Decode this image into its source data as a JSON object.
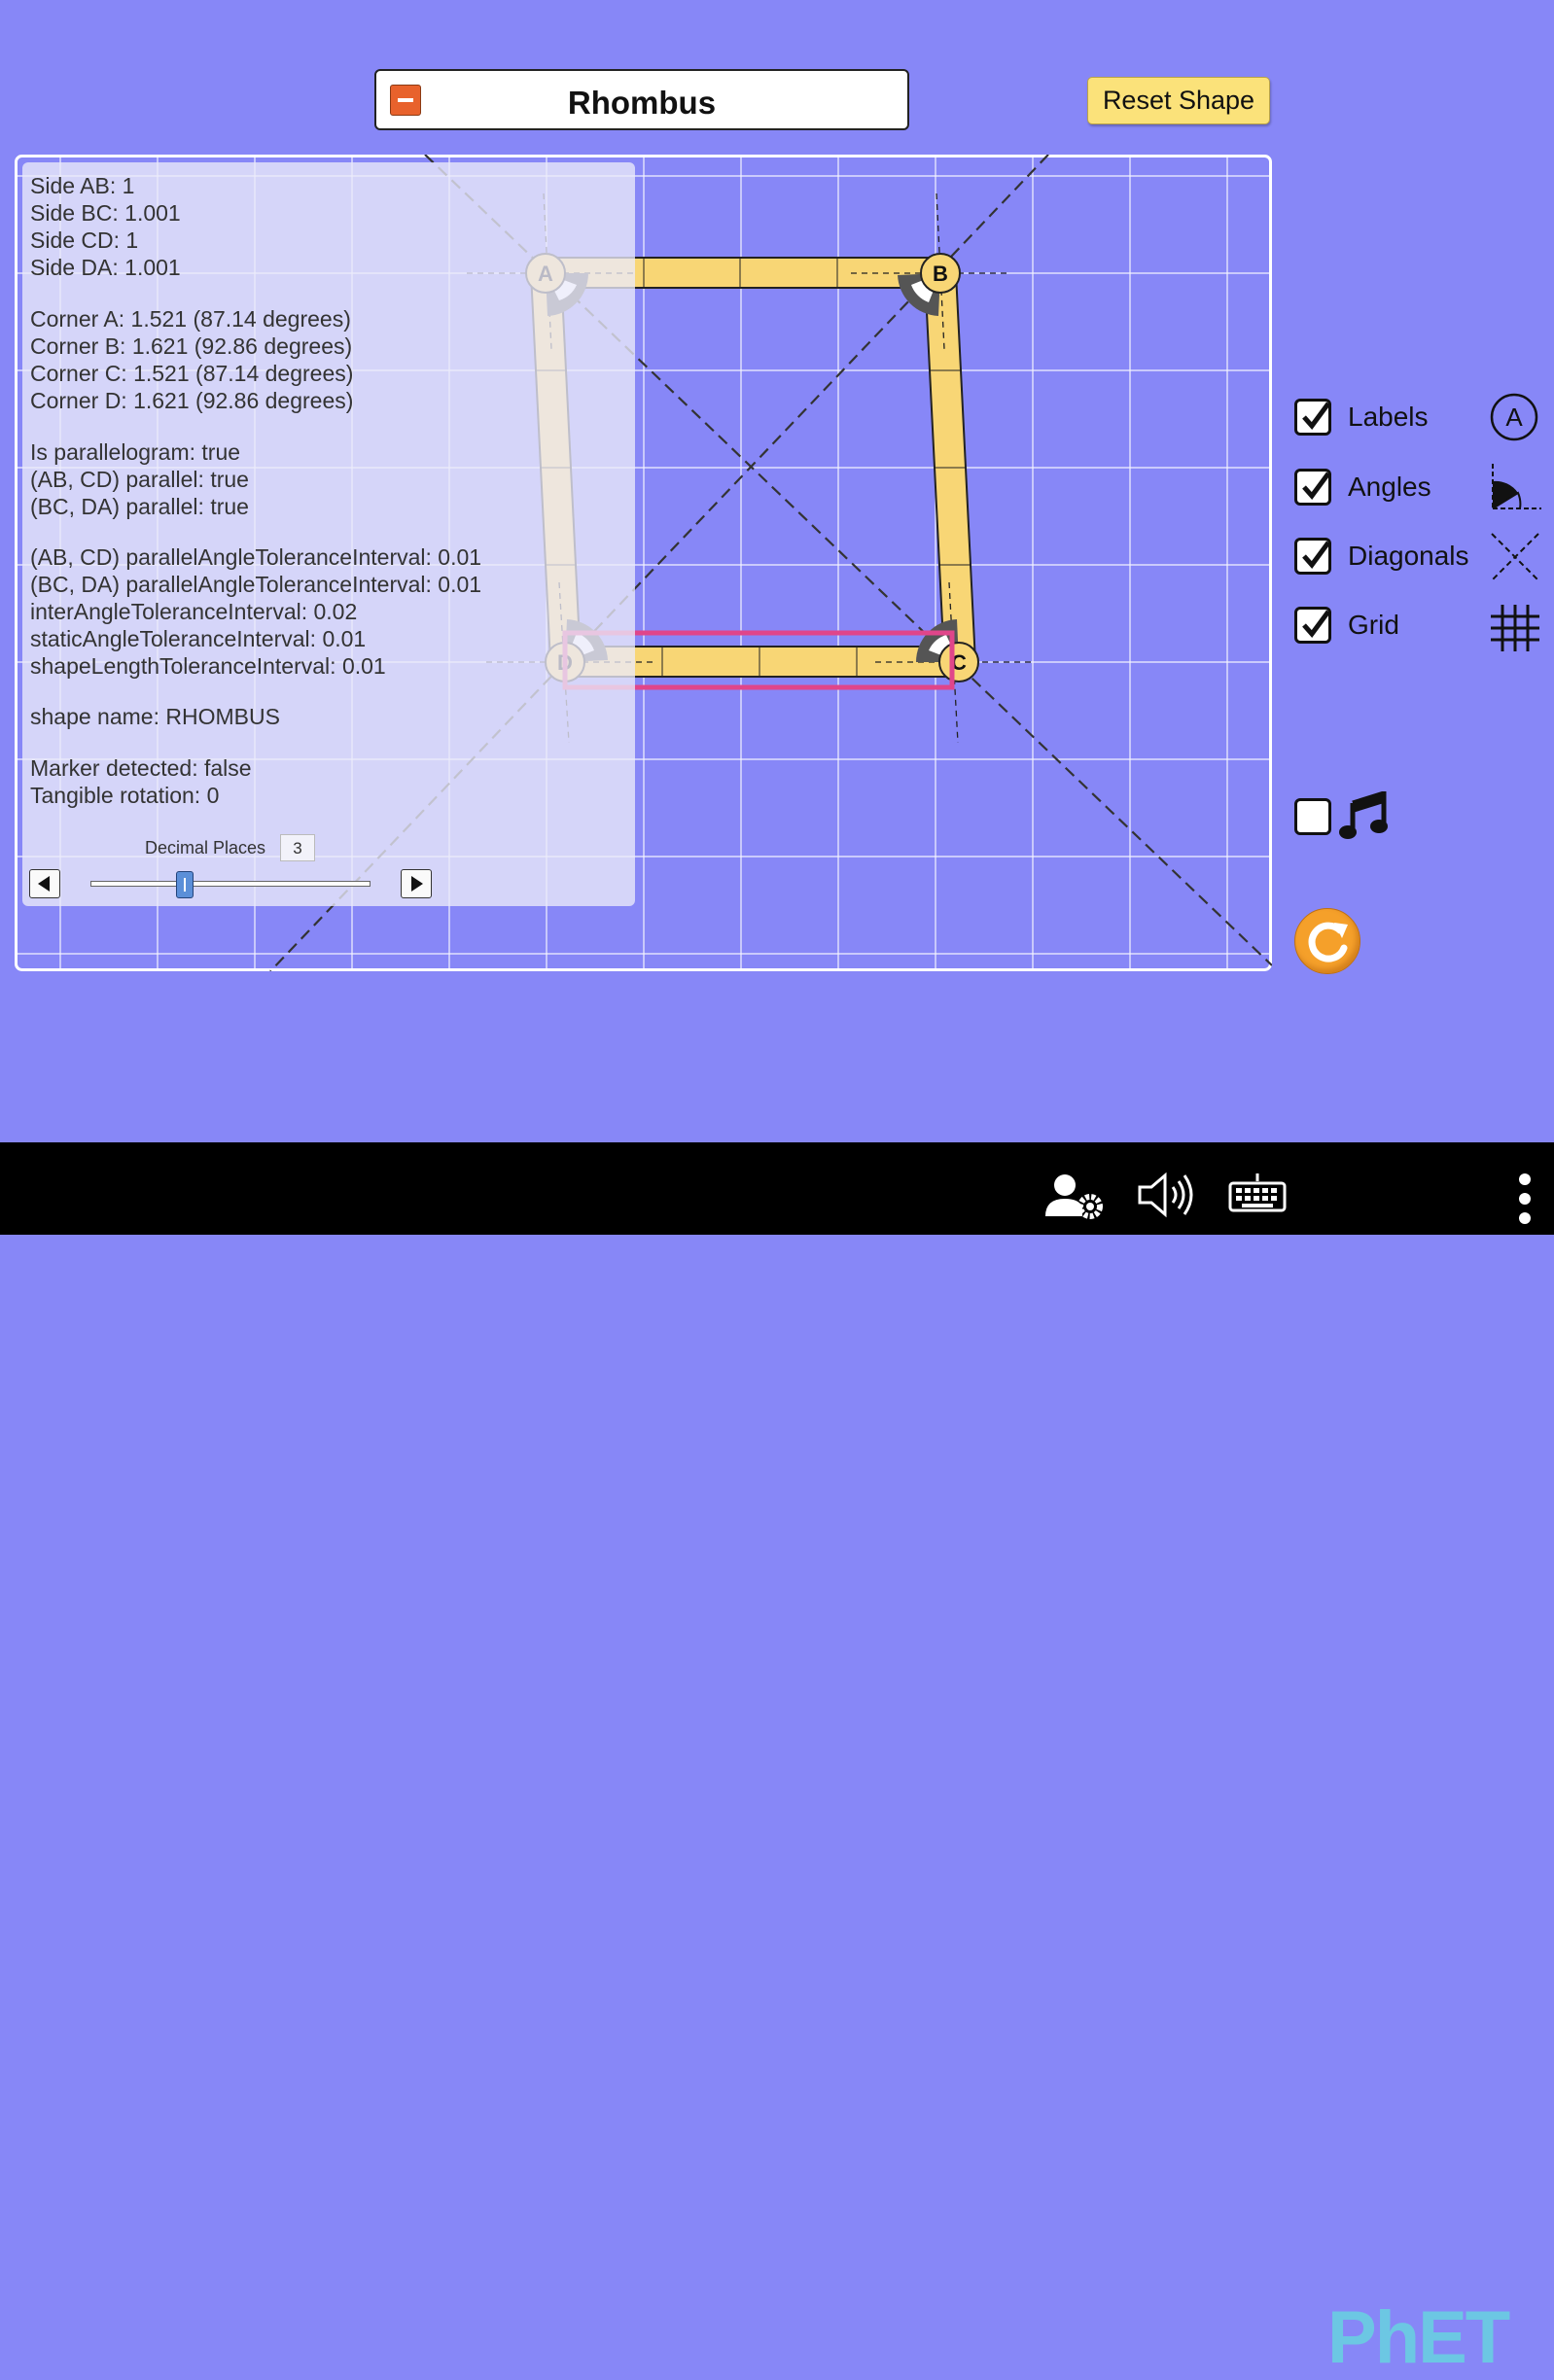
{
  "header": {
    "title": "Rhombus",
    "reset_label": "Reset Shape"
  },
  "info": {
    "lines": [
      "Side AB: 1",
      "Side BC: 1.001",
      "Side CD: 1",
      "Side DA: 1.001",
      "Corner A: 1.521 (87.14 degrees)",
      "Corner B: 1.621 (92.86 degrees)",
      "Corner C: 1.521 (87.14 degrees)",
      "Corner D: 1.621 (92.86 degrees)",
      "Is parallelogram: true",
      "(AB, CD) parallel: true",
      "(BC, DA) parallel: true",
      "(AB, CD) parallelAngleToleranceInterval: 0.01",
      "(BC, DA) parallelAngleToleranceInterval: 0.01",
      "interAngleToleranceInterval: 0.02",
      "staticAngleToleranceInterval: 0.01",
      "shapeLengthToleranceInterval: 0.01",
      "shape name: RHOMBUS",
      "Marker detected: false",
      "Tangible rotation: 0"
    ],
    "decimal_places_label": "Decimal Places",
    "decimal_places_value": "3",
    "decimal_places_slider_fraction": 0.33
  },
  "vertices": {
    "a": "A",
    "b": "B",
    "c": "C",
    "d": "D"
  },
  "options": {
    "labels": {
      "label": "Labels",
      "checked": true,
      "icon": "circle-a-icon"
    },
    "angles": {
      "label": "Angles",
      "checked": true,
      "icon": "angle-wedge-icon"
    },
    "diagonals": {
      "label": "Diagonals",
      "checked": true,
      "icon": "diagonals-x-icon"
    },
    "grid": {
      "label": "Grid",
      "checked": true,
      "icon": "grid-icon"
    },
    "sound": {
      "checked": false,
      "icon": "music-note-icon"
    }
  },
  "navbar": {
    "brand": "PhET",
    "icons": [
      "user-settings-icon",
      "speaker-icon",
      "keyboard-icon",
      "phet-logo",
      "more-vertical-icon"
    ]
  },
  "colors": {
    "background": "#8787f7",
    "side_fill": "#f8d675",
    "highlight": "#e0458a",
    "reset_button": "#fbe27a",
    "collapse_button": "#e8622c"
  }
}
